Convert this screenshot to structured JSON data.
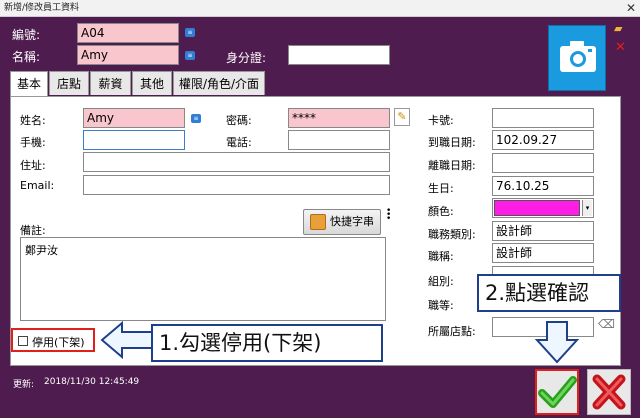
{
  "window": {
    "title": "新增/修改員工資料",
    "close": "✕"
  },
  "header": {
    "code_label": "編號:",
    "code_value": "A04",
    "name_label": "名稱:",
    "name_value": "Amy",
    "id_label": "身分證:",
    "id_value": ""
  },
  "tabs": [
    "基本",
    "店點",
    "薪資",
    "其他",
    "權限/角色/介面"
  ],
  "basic": {
    "surname_label": "姓名:",
    "surname_value": "Amy",
    "password_label": "密碼:",
    "password_value": "****",
    "mobile_label": "手機:",
    "mobile_value": "",
    "phone_label": "電話:",
    "phone_value": "",
    "address_label": "住址:",
    "address_value": "",
    "email_label": "Email:",
    "email_value": "",
    "memo_label": "備註:",
    "memo_value": "鄭尹汝",
    "quick_button": "快捷字串",
    "card_label": "卡號:",
    "card_value": "",
    "hire_label": "到職日期:",
    "hire_value": "102.09.27",
    "leave_label": "離職日期:",
    "leave_value": "",
    "birthday_label": "生日:",
    "birthday_value": "76.10.25",
    "color_label": "顏色:",
    "color_value": "#ff1ee6",
    "jobtype_label": "職務類別:",
    "jobtype_value": "設計師",
    "title_label": "職稱:",
    "title_value": "設計師",
    "group_label": "組別:",
    "group_value": "",
    "grade_label": "職等:",
    "grade_value": "",
    "store_label": "所屬店點:",
    "store_value": "",
    "disable_label": "停用(下架)"
  },
  "callouts": {
    "step1": "1.勾選停用(下架)",
    "step2": "2.點選確認"
  },
  "footer": {
    "updated_label": "更新:",
    "updated_value": "2018/11/30 12:45:49"
  },
  "colors": {
    "accent_border": "#e0201a",
    "callout_border": "#1d3f8c",
    "bg": "#4e1c4e",
    "pink_field": "#f8c6cc"
  }
}
